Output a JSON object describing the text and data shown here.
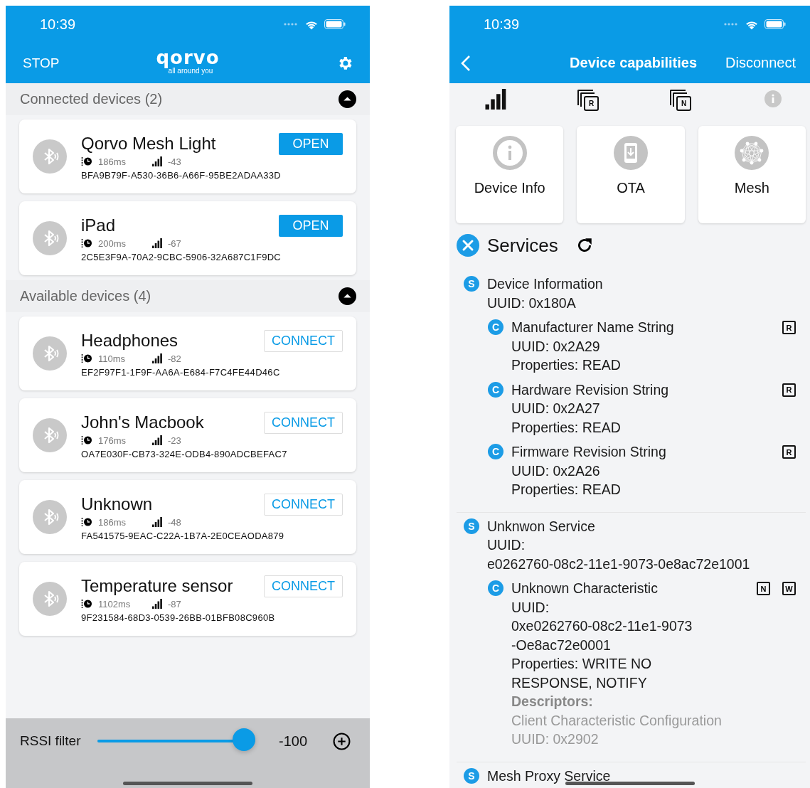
{
  "left_screen": {
    "status_bar": {
      "time": "10:39"
    },
    "nav_bar": {
      "stop_label": "STOP",
      "logo": "qorvo",
      "logo_tagline": "all around you"
    },
    "sections": [
      {
        "title": "Connected devices (2)",
        "expanded": true,
        "devices": [
          {
            "name": "Qorvo Mesh Light",
            "interval": "186ms",
            "rssi": "-43",
            "uuid": "BFA9B79F-A530-36B6-A66F-95BE2ADAA33D",
            "button": {
              "label": "OPEN",
              "kind": "filled"
            }
          },
          {
            "name": "iPad",
            "interval": "200ms",
            "rssi": "-67",
            "uuid": "2C5E3F9A-70A2-9CBC-5906-32A687C1F9DC",
            "button": {
              "label": "OPEN",
              "kind": "filled"
            }
          }
        ]
      },
      {
        "title": "Available devices (4)",
        "expanded": true,
        "devices": [
          {
            "name": "Headphones",
            "interval": "110ms",
            "rssi": "-82",
            "uuid": "EF2F97F1-1F9F-AA6A-E684-F7C4FE44D46C",
            "button": {
              "label": "CONNECT",
              "kind": "outlined"
            }
          },
          {
            "name": "John's Macbook",
            "interval": "176ms",
            "rssi": "-23",
            "uuid": "OA7E030F-CB73-324E-ODB4-890ADCBEFAC7",
            "button": {
              "label": "CONNECT",
              "kind": "outlined"
            }
          },
          {
            "name": "Unknown",
            "interval": "186ms",
            "rssi": "-48",
            "uuid": "FA541575-9EAC-C22A-1B7A-2E0CEAODA879",
            "button": {
              "label": "CONNECT",
              "kind": "outlined"
            }
          },
          {
            "name": "Temperature sensor",
            "interval": "1102ms",
            "rssi": "-87",
            "uuid": "9F231584-68D3-0539-26BB-01BFB08C960B",
            "button": {
              "label": "CONNECT",
              "kind": "outlined"
            }
          }
        ]
      }
    ],
    "rssi_filter": {
      "label": "RSSI filter",
      "level": 0.93,
      "reading": "-100"
    }
  },
  "right_screen": {
    "status_bar": {
      "time": "10:39"
    },
    "nav_bar": {
      "title": "Device capabilities",
      "action": "Disconnect"
    },
    "capability_icons": [
      {
        "kind": "signal",
        "disabled": false
      },
      {
        "kind": "stack",
        "letter": "R",
        "disabled": false
      },
      {
        "kind": "stack",
        "letter": "N",
        "disabled": false
      },
      {
        "kind": "info",
        "disabled": true
      }
    ],
    "tiles": [
      {
        "label": "Device Info",
        "kind": "info"
      },
      {
        "label": "OTA",
        "kind": "ota"
      },
      {
        "label": "Mesh",
        "kind": "mesh"
      }
    ],
    "services_header": {
      "title": "Services"
    },
    "services": [
      {
        "badge": "S",
        "name": "Device Information",
        "lines": [
          "UUID: 0x180A"
        ],
        "characteristics": [
          {
            "badge": "C",
            "name": "Manufacturer Name String",
            "lines": [
              "UUID: 0x2A29",
              "Properties: READ"
            ],
            "properties": [
              "R"
            ]
          },
          {
            "badge": "C",
            "name": "Hardware Revision String",
            "lines": [
              "UUID: 0x2A27",
              "Properties: READ"
            ],
            "properties": [
              "R"
            ]
          },
          {
            "badge": "C",
            "name": "Firmware Revision String",
            "lines": [
              "UUID: 0x2A26",
              "Properties: READ"
            ],
            "properties": [
              "R"
            ]
          }
        ]
      },
      {
        "badge": "S",
        "name": "Unknwon Service",
        "lines": [
          "UUID:",
          "e0262760-08c2-11e1-9073-0e8ac72e1001"
        ],
        "characteristics": [
          {
            "badge": "C",
            "name": "Unknown Characteristic",
            "lines": [
              "UUID:",
              "0xe0262760-08c2-11e1-9073",
              "-Oe8ac72e0001",
              "Properties: WRITE NO",
              "RESPONSE, NOTIFY"
            ],
            "properties": [
              "N",
              "W"
            ],
            "descriptors": {
              "label": "Descriptors:",
              "items": [
                {
                  "name": "Client Characteristic Configuration",
                  "uuid": "UUID: 0x2902"
                }
              ]
            }
          }
        ]
      },
      {
        "badge": "S",
        "name": "Mesh Proxy Service"
      }
    ]
  }
}
